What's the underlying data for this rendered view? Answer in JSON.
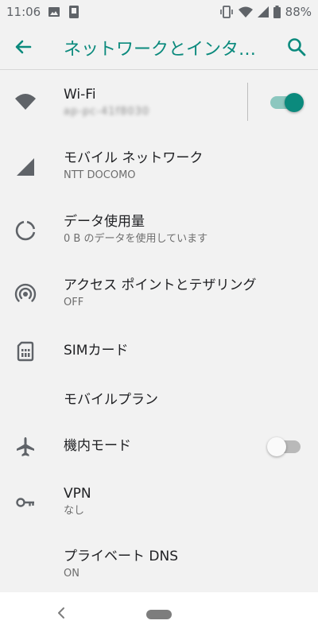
{
  "status_bar": {
    "time": "11:06",
    "battery_percent": "88%"
  },
  "app_bar": {
    "title": "ネットワークとインターネット",
    "back_icon": "arrow-back-icon",
    "search_icon": "search-icon"
  },
  "colors": {
    "accent": "#0b8a7d",
    "background": "#f2f2f2"
  },
  "settings": {
    "wifi": {
      "title": "Wi-Fi",
      "subtitle": "ap-pc-41f8030",
      "icon": "wifi-icon",
      "enabled": true
    },
    "mobile_network": {
      "title": "モバイル ネットワーク",
      "subtitle": "NTT DOCOMO",
      "icon": "signal-icon"
    },
    "data_usage": {
      "title": "データ使用量",
      "subtitle": "0 B のデータを使用しています",
      "icon": "data-usage-icon"
    },
    "hotspot": {
      "title": "アクセス ポイントとテザリング",
      "subtitle": "OFF",
      "icon": "hotspot-icon"
    },
    "sim": {
      "title": "SIMカード",
      "icon": "sim-card-icon"
    },
    "mobile_plan": {
      "title": "モバイルプラン"
    },
    "airplane": {
      "title": "機内モード",
      "icon": "airplane-icon",
      "enabled": false
    },
    "vpn": {
      "title": "VPN",
      "subtitle": "なし",
      "icon": "vpn-key-icon"
    },
    "private_dns": {
      "title": "プライベート DNS",
      "subtitle": "ON"
    }
  },
  "nav_bar": {
    "back_icon": "nav-back-icon",
    "home_icon": "home-pill-icon"
  }
}
